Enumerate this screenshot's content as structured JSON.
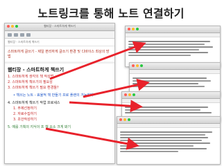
{
  "page": {
    "title": "노트링크를 통해 노트 연결하기"
  },
  "main_window": {
    "window_title": "웹티장 - 스마트하게 책쓰기",
    "field": "웹티장 - 스마트하게 책쓰기",
    "path_text": "스마트하게 글쓰기 - 제일 편리하게 글쓰기 환경 및 디바이스 최상의 방법",
    "heading": "웹티장 - 스마트하게 책쓰기",
    "items": [
      {
        "text": "1. 스마트하게 생각의 책 작성법",
        "color": "#c62828"
      },
      {
        "text": "2. 스마트하게 책쓰기의 필요성",
        "color": "#c62828"
      },
      {
        "text": "3. 스마트하게 책쓰기 필요 환경들?",
        "color": "#c62828"
      },
      {
        "text": "• 책쓰는 노트 - 효율적 책 만들기 프로 플랜의 가능하다",
        "color": "#1a53c8"
      },
      {
        "text": "4. 스마트하게 책쓰기 작업 프로세스",
        "color": "#222222"
      },
      {
        "text": "1. 주제선정하기",
        "color": "#c62828"
      },
      {
        "text": "2. 자료수집하기",
        "color": "#c62828"
      },
      {
        "text": "3. 초안작성하기",
        "color": "#c62828"
      },
      {
        "text": "5. 예를 기획의 지식이 프 책 요소 크게 봐기",
        "color": "#2e7d32"
      }
    ]
  },
  "colors": {
    "arrow": "#e8222b",
    "window_border": "#b9b9b9"
  }
}
